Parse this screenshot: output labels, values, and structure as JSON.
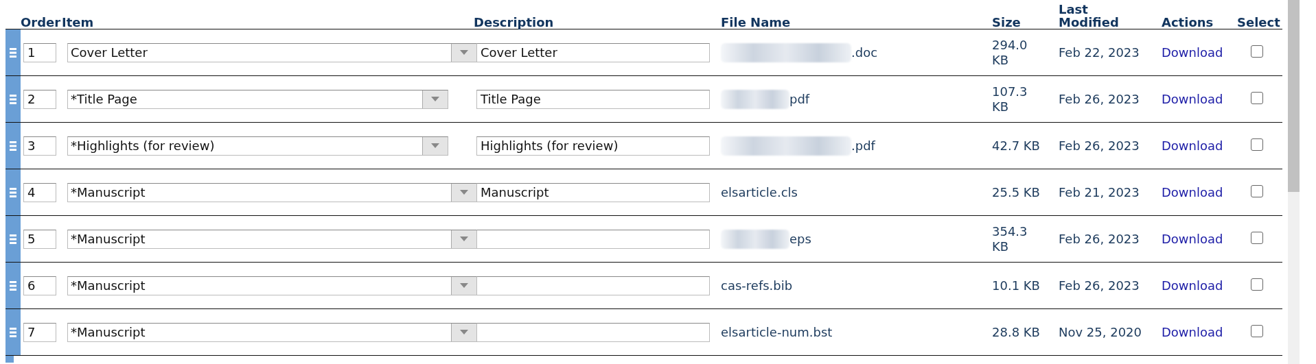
{
  "table": {
    "columns": [
      "Order",
      "Item",
      "Description",
      "File Name",
      "Size",
      "Last Modified",
      "Actions",
      "Select"
    ],
    "rows": [
      {
        "order": "1",
        "item": "Cover Letter",
        "description": "Cover Letter",
        "file_name": ".doc",
        "redacted": true,
        "size": "294.0 KB",
        "modified": "Feb 22, 2023",
        "action": "Download",
        "checked": false
      },
      {
        "order": "2",
        "item": "*Title Page",
        "description": "Title Page",
        "file_name": "pdf",
        "redacted": true,
        "size": "107.3 KB",
        "modified": "Feb 26, 2023",
        "action": "Download",
        "checked": false
      },
      {
        "order": "3",
        "item": "*Highlights (for review)",
        "description": "Highlights (for review)",
        "file_name": ".pdf",
        "redacted": true,
        "size": "42.7 KB",
        "modified": "Feb 26, 2023",
        "action": "Download",
        "checked": false
      },
      {
        "order": "4",
        "item": "*Manuscript",
        "description": "Manuscript",
        "file_name": "elsarticle.cls",
        "redacted": false,
        "size": "25.5 KB",
        "modified": "Feb 21, 2023",
        "action": "Download",
        "checked": false
      },
      {
        "order": "5",
        "item": "*Manuscript",
        "file_name": "eps",
        "redacted": true,
        "size": "354.3 KB",
        "modified": "Feb 26, 2023",
        "action": "Download",
        "checked": false
      },
      {
        "order": "6",
        "item": "*Manuscript",
        "file_name": "cas-refs.bib",
        "redacted": false,
        "size": "10.1 KB",
        "modified": "Feb 26, 2023",
        "action": "Download",
        "checked": false
      },
      {
        "order": "7",
        "item": "*Manuscript",
        "file_name": "elsarticle-num.bst",
        "redacted": false,
        "size": "28.8 KB",
        "modified": "Nov 25, 2020",
        "action": "Download",
        "checked": false
      }
    ]
  }
}
